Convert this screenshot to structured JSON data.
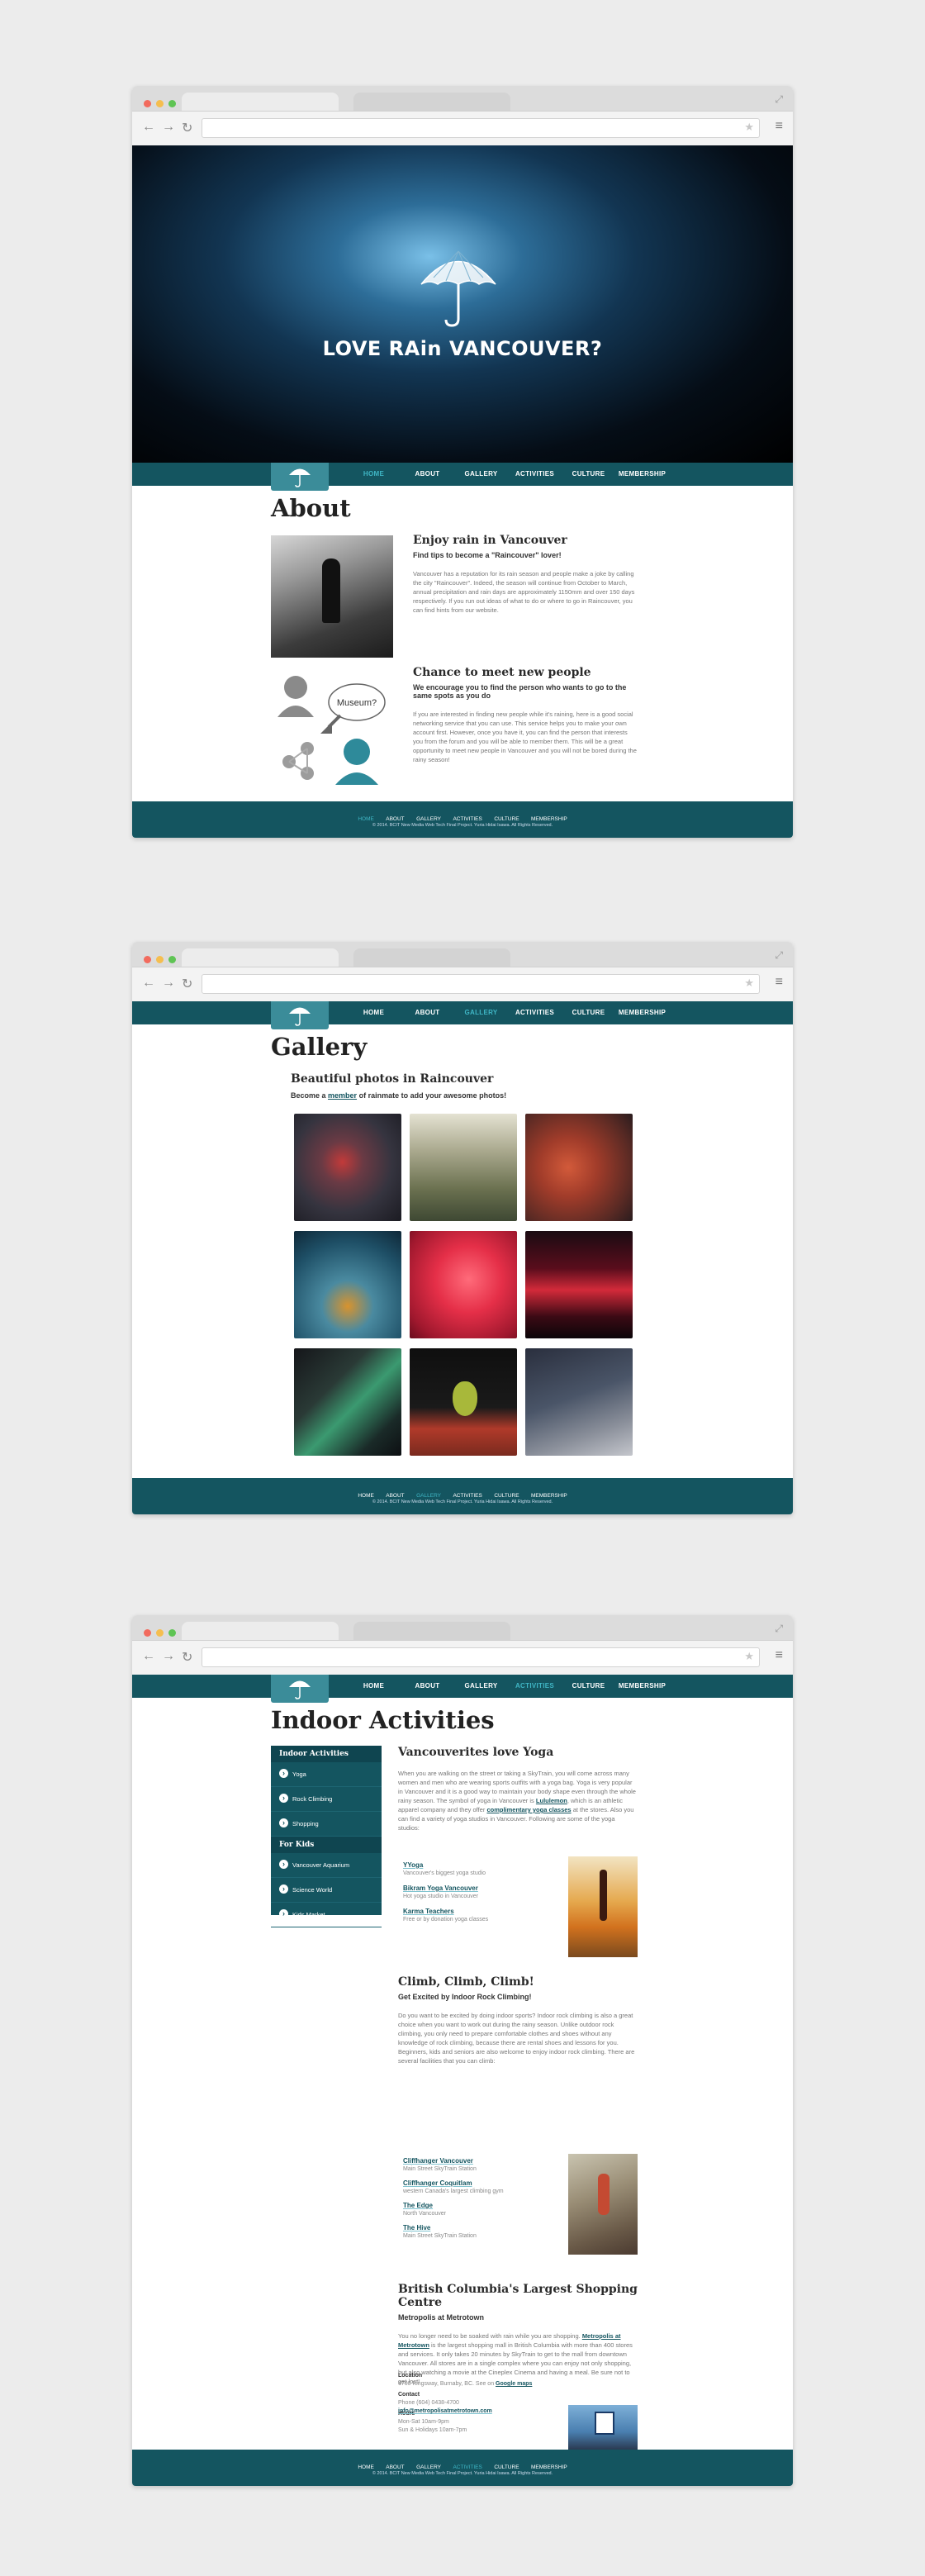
{
  "nav": {
    "home": "HOME",
    "about": "ABOUT",
    "gallery": "GALLERY",
    "activities": "ACTIVITIES",
    "culture": "CULTURE",
    "membership": "MEMBERSHIP"
  },
  "hero": {
    "title": "LOVE RAin VANCOUVER?"
  },
  "about": {
    "title": "About",
    "section1": {
      "heading": "Enjoy rain in Vancouver",
      "subheading": "Find tips to become a \"Raincouver\" lover!",
      "text": "Vancouver has a reputation for its rain season and people make a joke by calling the city \"Raincouver\". Indeed, the season will continue from October to March, annual precipitation and rain days are approximately 1150mm and over 150 days respectively. If you run out ideas of what to do or where to go in Raincouver, you can find hints from our website."
    },
    "section2": {
      "heading": "Chance to meet new people",
      "subheading": "We encourage you to find the person who wants to go to the same spots as you do",
      "text": "If you are interested in finding new people while it's raining, here is a good social networking service that you can use. This service helps you to make your own account first. However, once you have it, you can find the person that interests you from the forum and you will be able to member them. This will be a great opportunity to meet new people in Vancouver and you will not be bored during the rainy season!",
      "bubble": "Museum?"
    }
  },
  "footer": {
    "copyright": "© 2014. BCIT New Media Web Tech Final Project. Yuria Hidai Isawa. All Rights Reserved."
  },
  "gallery": {
    "title": "Gallery",
    "heading": "Beautiful photos in Raincouver",
    "sub_before": "Become a",
    "sub_link": "member",
    "sub_after": "of rainmate to add your awesome photos!",
    "photos": [
      "woman-umbrella",
      "reeds",
      "red-leaves",
      "boat-water",
      "red-drops",
      "city-night",
      "umbrella-edge",
      "pear",
      "woman-rain"
    ]
  },
  "activities": {
    "title": "Indoor Activities",
    "sidebar": {
      "indoor_header": "Indoor Activities",
      "indoor_items": [
        "Yoga",
        "Rock Climbing",
        "Shopping"
      ],
      "kids_header": "For Kids",
      "kids_items": [
        "Vancouver Aquarium",
        "Science World",
        "Kids Market"
      ]
    },
    "yoga": {
      "heading": "Vancouverites love Yoga",
      "text_a": "When you are walking on the street or taking a SkyTrain, you will come across many women and men who are wearing sports outfits with a yoga bag. Yoga is very popular in Vancouver and it is a good way to maintain your body shape even through the whole rainy season. The symbol of yoga in Vancouver is",
      "link_a": "Lululemon",
      "text_b": ", which is an athletic apparel company and they offer",
      "link_b": "complimentary yoga classes",
      "text_c": "at the stores. Also you can find a variety of yoga studios in Vancouver. Following are some of the yoga studios:",
      "links": [
        {
          "name": "YYoga",
          "desc": "Vancouver's biggest yoga studio"
        },
        {
          "name": "Bikram Yoga Vancouver",
          "desc": "Hot yoga studio in Vancouver"
        },
        {
          "name": "Karma Teachers",
          "desc": "Free or by donation yoga classes"
        }
      ]
    },
    "climb": {
      "heading": "Climb, Climb, Climb!",
      "subheading": "Get Excited by Indoor Rock Climbing!",
      "text": "Do you want to be excited by doing indoor sports? Indoor rock climbing is also a great choice when you want to work out during the rainy season. Unlike outdoor rock climbing, you only need to prepare comfortable clothes and shoes without any knowledge of rock climbing, because there are rental shoes and lessons for you. Beginners, kids and seniors are also welcome to enjoy indoor rock climbing. There are several facilities that you can climb:",
      "links": [
        {
          "name": "Cliffhanger Vancouver",
          "desc": "Main Street SkyTrain Station"
        },
        {
          "name": "Cliffhanger Coquitlam",
          "desc": "western Canada's largest climbing gym"
        },
        {
          "name": "The Edge",
          "desc": "North Vancouver"
        },
        {
          "name": "The Hive",
          "desc": "Main Street SkyTrain Station"
        }
      ]
    },
    "shop": {
      "heading": "British Columbia's Largest Shopping Centre",
      "subheading": "Metropolis at Metrotown",
      "text_a": "You no longer need to be soaked with rain while you are shopping.",
      "link_a": "Metropolis at Metrotown",
      "text_b": "is the largest shopping mall in British Columbia with more than 400 stores and services. It only takes 20 minutes by SkyTrain to get to the mall from downtown Vancouver. All stores are in a single complex where you can enjoy not only shopping, but also watching a movie at the Cineplex Cinema and having a meal. Be sure not to get lost!",
      "hours_label": "Hours",
      "hours_1": "Mon-Sat 10am-9pm",
      "hours_2": "Sun & Holidays 10am-7pm",
      "location_label": "Location",
      "location_text": "4700 Kingsway, Burnaby, BC. See on",
      "location_link": "Google maps",
      "contact_label": "Contact",
      "phone": "Phone (604) 0438-4700",
      "email": "info@metropolisatmetrotown.com"
    }
  }
}
